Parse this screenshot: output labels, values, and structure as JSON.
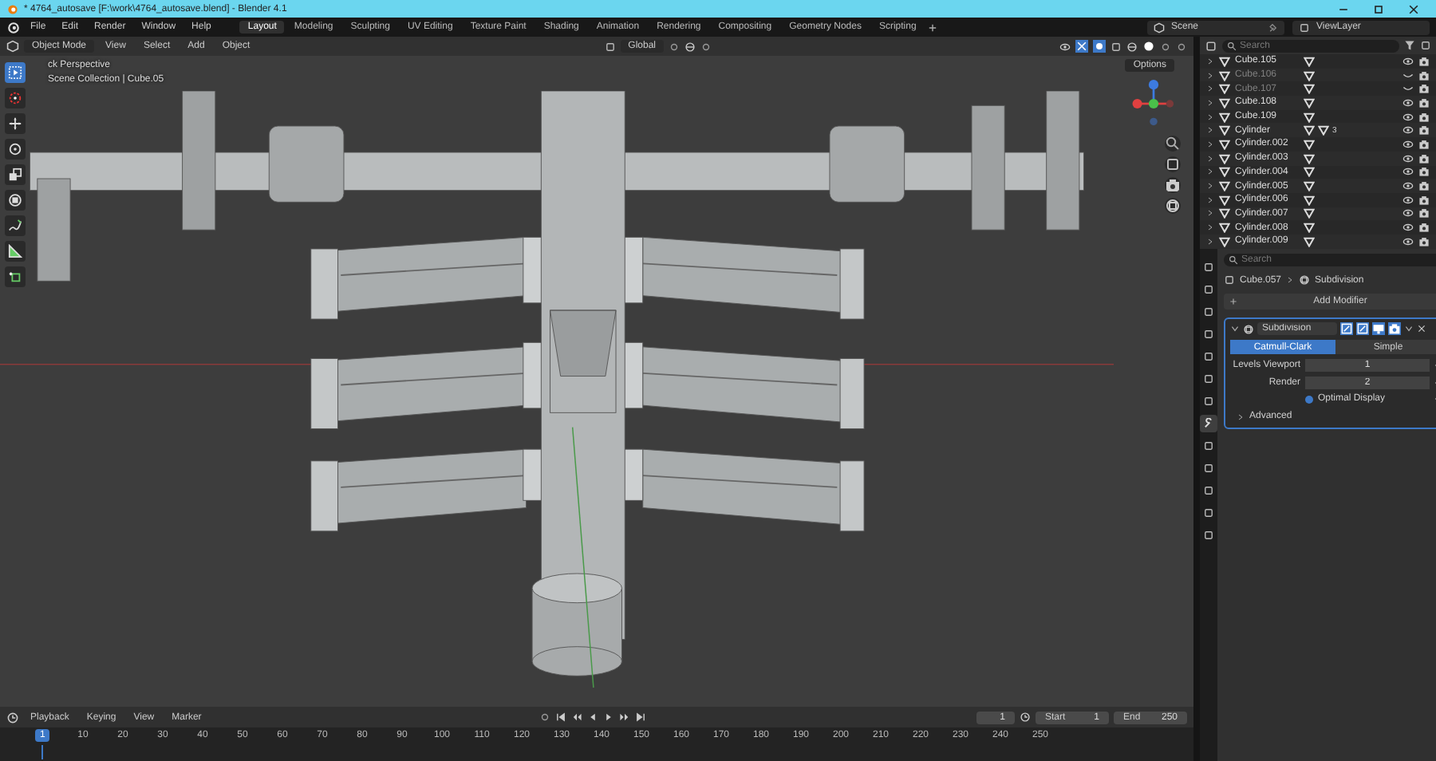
{
  "window": {
    "title": "* 4764_autosave [F:\\work\\4764_autosave.blend] - Blender 4.1"
  },
  "menu": [
    "File",
    "Edit",
    "Render",
    "Window",
    "Help"
  ],
  "workspaces": [
    {
      "label": "Layout",
      "selected": true
    },
    {
      "label": "Modeling",
      "selected": false
    },
    {
      "label": "Sculpting",
      "selected": false
    },
    {
      "label": "UV Editing",
      "selected": false
    },
    {
      "label": "Texture Paint",
      "selected": false
    },
    {
      "label": "Shading",
      "selected": false
    },
    {
      "label": "Animation",
      "selected": false
    },
    {
      "label": "Rendering",
      "selected": false
    },
    {
      "label": "Compositing",
      "selected": false
    },
    {
      "label": "Geometry Nodes",
      "selected": false
    },
    {
      "label": "Scripting",
      "selected": false
    }
  ],
  "scene": "Scene",
  "view_layer": "ViewLayer",
  "viewport": {
    "mode": "Object Mode",
    "menus": [
      "View",
      "Select",
      "Add",
      "Object"
    ],
    "orientation": "Global",
    "options": "Options",
    "view_name": "ck Perspective",
    "collection_path": "Scene Collection | Cube.05",
    "tools": [
      {
        "kind": "select",
        "selected": true
      },
      {
        "kind": "cursor",
        "selected": false
      },
      {
        "kind": "move",
        "selected": false
      },
      {
        "kind": "rotate",
        "selected": false
      },
      {
        "kind": "scale",
        "selected": false
      },
      {
        "kind": "transform",
        "selected": false
      },
      {
        "kind": "annotate",
        "selected": false
      },
      {
        "kind": "measure",
        "selected": false
      },
      {
        "kind": "addcube",
        "selected": false
      }
    ]
  },
  "outliner": {
    "search": {
      "placeholder": "Search"
    },
    "rows": [
      {
        "name": "Cube.105",
        "visible": true
      },
      {
        "name": "Cube.106",
        "visible": false
      },
      {
        "name": "Cube.107",
        "visible": false
      },
      {
        "name": "Cube.108",
        "visible": true
      },
      {
        "name": "Cube.109",
        "visible": true
      },
      {
        "name": "Cylinder",
        "visible": true,
        "count": "3"
      },
      {
        "name": "Cylinder.002",
        "visible": true
      },
      {
        "name": "Cylinder.003",
        "visible": true
      },
      {
        "name": "Cylinder.004",
        "visible": true
      },
      {
        "name": "Cylinder.005",
        "visible": true
      },
      {
        "name": "Cylinder.006",
        "visible": true
      },
      {
        "name": "Cylinder.007",
        "visible": true
      },
      {
        "name": "Cylinder.008",
        "visible": true
      },
      {
        "name": "Cylinder.009",
        "visible": true
      }
    ]
  },
  "properties": {
    "search": {
      "placeholder": "Search"
    },
    "tabs": [
      {
        "selected": false
      },
      {
        "selected": false
      },
      {
        "selected": false
      },
      {
        "selected": false
      },
      {
        "selected": false
      },
      {
        "selected": false
      },
      {
        "selected": false
      },
      {
        "selected": true
      },
      {
        "selected": false
      },
      {
        "selected": false
      },
      {
        "selected": false
      },
      {
        "selected": false
      },
      {
        "selected": false
      }
    ],
    "object": "Cube.057",
    "modifier_crumb": "Subdivision",
    "add_modifier": "Add Modifier",
    "modifier": {
      "name": "Subdivision",
      "expanded": true,
      "types": [
        {
          "label": "Catmull-Clark",
          "selected": true
        },
        {
          "label": "Simple",
          "selected": false
        }
      ],
      "fields": [
        {
          "label": "Levels Viewport",
          "value": "1"
        },
        {
          "label": "Render",
          "value": "2"
        }
      ],
      "optimal_display": {
        "label": "Optimal Display",
        "checked": true
      },
      "advanced": {
        "label": "Advanced",
        "expanded": false
      }
    }
  },
  "timeline": {
    "menus": [
      "Playback",
      "Keying",
      "View",
      "Marker"
    ],
    "frame": "1",
    "start_label": "Start",
    "start": "1",
    "end_label": "End",
    "end": "250",
    "current": "1",
    "ruler": [
      "10",
      "20",
      "30",
      "40",
      "50",
      "60",
      "70",
      "80",
      "90",
      "100",
      "110",
      "120",
      "130",
      "140",
      "150",
      "160",
      "170",
      "180",
      "190",
      "200",
      "210",
      "220",
      "230",
      "240",
      "250"
    ]
  }
}
